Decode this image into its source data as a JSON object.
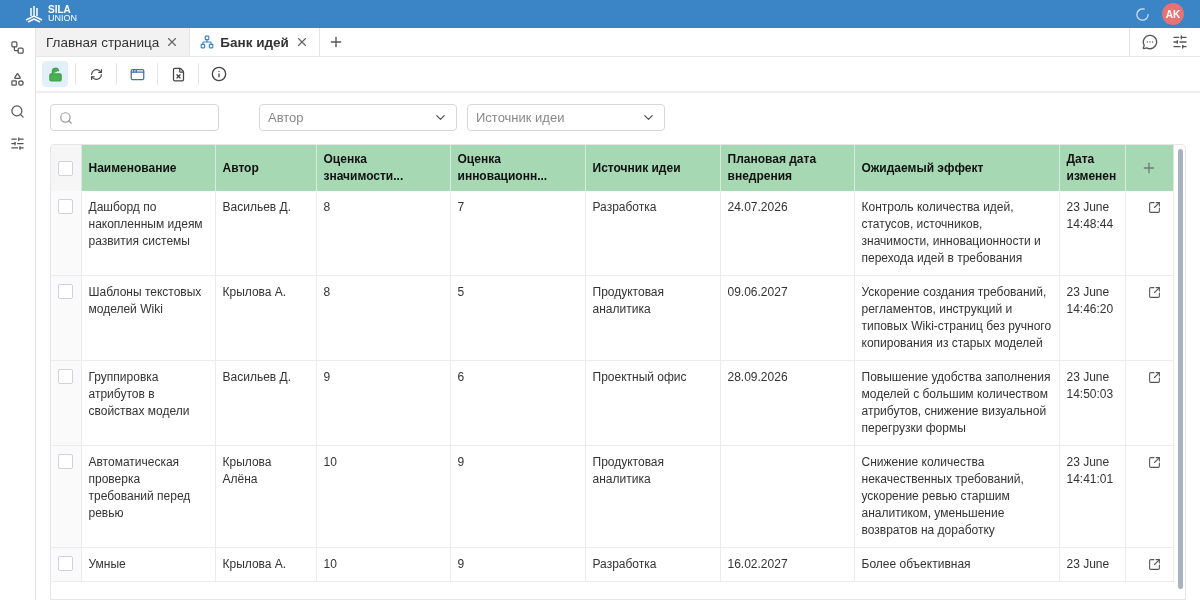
{
  "header": {
    "logo": {
      "line1": "SILA",
      "line2": "UNION"
    },
    "avatar": "AK"
  },
  "tabs": [
    {
      "label": "Главная страница",
      "kind": "plain",
      "selected": false
    },
    {
      "label": "Банк идей",
      "kind": "tree",
      "selected": true
    }
  ],
  "toolbar": [
    {
      "kind": "lock",
      "selected": true
    },
    {
      "kind": "refresh",
      "selected": false
    },
    {
      "kind": "window",
      "selected": false
    },
    {
      "kind": "excel",
      "selected": false
    },
    {
      "kind": "info",
      "selected": false
    }
  ],
  "filters": {
    "author": {
      "placeholder": "Автор"
    },
    "source": {
      "placeholder": "Источник идеи"
    }
  },
  "table": {
    "header_checked": false,
    "columns": [
      "Наименование",
      "Автор",
      "Оценка значимости...",
      "Оценка инновационн...",
      "Источник идеи",
      "Плановая дата внедрения",
      "Ожидаемый эффект",
      "Дата изменен"
    ],
    "rows": [
      {
        "checked": false,
        "name": "Дашборд по накопленным идеям развития системы",
        "author": "Васильев Д.",
        "significance": "8",
        "innovation": "7",
        "source": "Разработка",
        "planned_date": "24.07.2026",
        "effect": "Контроль количества идей, статусов, источников, значимости, инновационности и перехода идей в требования",
        "changed_date": "23 June",
        "changed_time": "14:48:44"
      },
      {
        "checked": false,
        "name": "Шаблоны текстовых моделей Wiki",
        "author": "Крылова А.",
        "significance": "8",
        "innovation": "5",
        "source": "Продуктовая аналитика",
        "planned_date": "09.06.2027",
        "effect": "Ускорение создания требований, регламентов, инструкций и типовых Wiki-страниц без ручного копирования из старых моделей",
        "changed_date": "23 June",
        "changed_time": "14:46:20"
      },
      {
        "checked": false,
        "name": "Группировка атрибутов в свойствах модели",
        "author": "Васильев Д.",
        "significance": "9",
        "innovation": "6",
        "source": "Проектный офис",
        "planned_date": "28.09.2026",
        "effect": "Повышение удобства заполнения моделей с большим количеством атрибутов, снижение визуальной перегрузки формы",
        "changed_date": "23 June",
        "changed_time": "14:50:03"
      },
      {
        "checked": false,
        "name": "Автоматическая проверка требований перед ревью",
        "author": "Крылова Алёна",
        "significance": "10",
        "innovation": "9",
        "source": "Продуктовая аналитика",
        "effect": "Снижение количества некачественных требований, ускорение ревью старшим аналитиком, уменьшение возвратов на доработку",
        "changed_date": "23 June",
        "changed_time": "14:41:01"
      },
      {
        "checked": false,
        "name": "Умные",
        "author": "Крылова А.",
        "significance": "10",
        "innovation": "9",
        "source": "Разработка",
        "planned_date": "16.02.2027",
        "effect": "Более объективная",
        "changed_date": "23 June"
      }
    ]
  }
}
